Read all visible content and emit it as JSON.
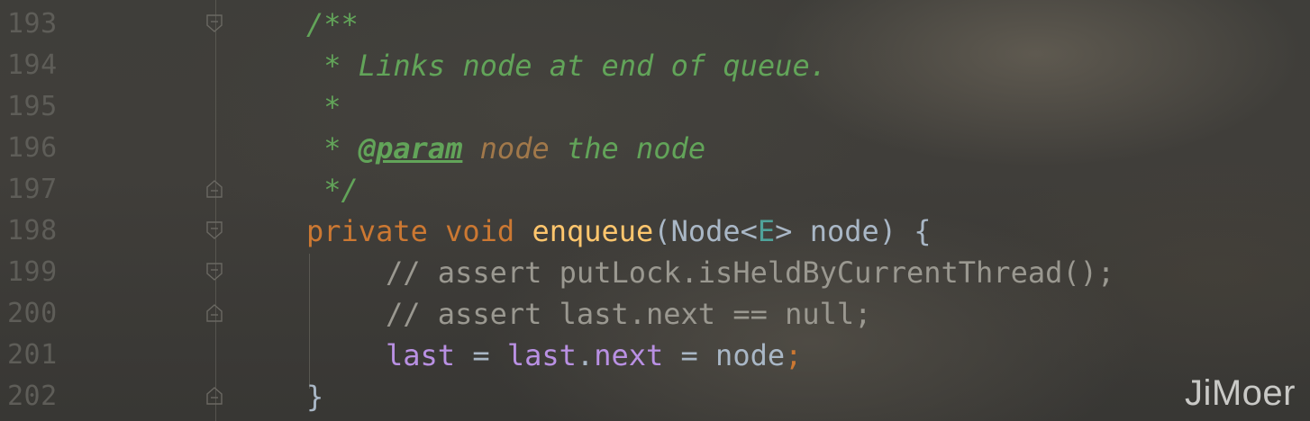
{
  "lines": [
    {
      "no": "193",
      "fold": "open"
    },
    {
      "no": "194",
      "fold": ""
    },
    {
      "no": "195",
      "fold": ""
    },
    {
      "no": "196",
      "fold": ""
    },
    {
      "no": "197",
      "fold": "close"
    },
    {
      "no": "198",
      "fold": "open"
    },
    {
      "no": "199",
      "fold": "open"
    },
    {
      "no": "200",
      "fold": "close"
    },
    {
      "no": "201",
      "fold": ""
    },
    {
      "no": "202",
      "fold": "close"
    }
  ],
  "code": {
    "l193": {
      "doc_open": "/**"
    },
    "l194": {
      "doc_text": " * Links node at end of queue."
    },
    "l195": {
      "doc_star": " *"
    },
    "l196": {
      "star": " * ",
      "tag": "@param",
      "param": " node",
      "rest": " the node"
    },
    "l197": {
      "doc_close": " */"
    },
    "l198": {
      "kw1": "private",
      "kw2": " void ",
      "method": "enqueue",
      "p1": "(Node<",
      "generic": "E",
      "p2": "> node) {"
    },
    "l199": {
      "comment": "// assert putLock.isHeldByCurrentThread();"
    },
    "l200": {
      "comment": "// assert last.next == null;"
    },
    "l201": {
      "f1": "last",
      "eq1": " = ",
      "f2": "last",
      "dot": ".",
      "f3": "next",
      "eq2": " = ",
      "val": "node",
      "semi": ";"
    },
    "l202": {
      "brace": "}"
    }
  },
  "watermark": "JiMoer",
  "colors": {
    "keyword": "#cc7832",
    "method": "#ffc66d",
    "plain": "#a9b7c6",
    "doc": "#62a459",
    "comment": "#9a9890",
    "field": "#b990e3",
    "line_number": "#5e5d58"
  }
}
